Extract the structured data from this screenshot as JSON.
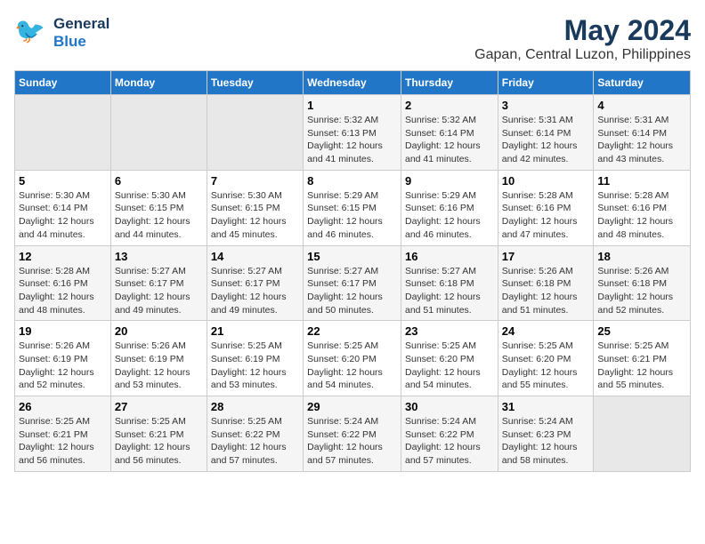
{
  "logo": {
    "general": "General",
    "blue": "Blue",
    "tagline": ""
  },
  "title": "May 2024",
  "subtitle": "Gapan, Central Luzon, Philippines",
  "days_of_week": [
    "Sunday",
    "Monday",
    "Tuesday",
    "Wednesday",
    "Thursday",
    "Friday",
    "Saturday"
  ],
  "weeks": [
    [
      {
        "day": "",
        "sunrise": "",
        "sunset": "",
        "daylight": ""
      },
      {
        "day": "",
        "sunrise": "",
        "sunset": "",
        "daylight": ""
      },
      {
        "day": "",
        "sunrise": "",
        "sunset": "",
        "daylight": ""
      },
      {
        "day": "1",
        "sunrise": "Sunrise: 5:32 AM",
        "sunset": "Sunset: 6:13 PM",
        "daylight": "Daylight: 12 hours and 41 minutes."
      },
      {
        "day": "2",
        "sunrise": "Sunrise: 5:32 AM",
        "sunset": "Sunset: 6:14 PM",
        "daylight": "Daylight: 12 hours and 41 minutes."
      },
      {
        "day": "3",
        "sunrise": "Sunrise: 5:31 AM",
        "sunset": "Sunset: 6:14 PM",
        "daylight": "Daylight: 12 hours and 42 minutes."
      },
      {
        "day": "4",
        "sunrise": "Sunrise: 5:31 AM",
        "sunset": "Sunset: 6:14 PM",
        "daylight": "Daylight: 12 hours and 43 minutes."
      }
    ],
    [
      {
        "day": "5",
        "sunrise": "Sunrise: 5:30 AM",
        "sunset": "Sunset: 6:14 PM",
        "daylight": "Daylight: 12 hours and 44 minutes."
      },
      {
        "day": "6",
        "sunrise": "Sunrise: 5:30 AM",
        "sunset": "Sunset: 6:15 PM",
        "daylight": "Daylight: 12 hours and 44 minutes."
      },
      {
        "day": "7",
        "sunrise": "Sunrise: 5:30 AM",
        "sunset": "Sunset: 6:15 PM",
        "daylight": "Daylight: 12 hours and 45 minutes."
      },
      {
        "day": "8",
        "sunrise": "Sunrise: 5:29 AM",
        "sunset": "Sunset: 6:15 PM",
        "daylight": "Daylight: 12 hours and 46 minutes."
      },
      {
        "day": "9",
        "sunrise": "Sunrise: 5:29 AM",
        "sunset": "Sunset: 6:16 PM",
        "daylight": "Daylight: 12 hours and 46 minutes."
      },
      {
        "day": "10",
        "sunrise": "Sunrise: 5:28 AM",
        "sunset": "Sunset: 6:16 PM",
        "daylight": "Daylight: 12 hours and 47 minutes."
      },
      {
        "day": "11",
        "sunrise": "Sunrise: 5:28 AM",
        "sunset": "Sunset: 6:16 PM",
        "daylight": "Daylight: 12 hours and 48 minutes."
      }
    ],
    [
      {
        "day": "12",
        "sunrise": "Sunrise: 5:28 AM",
        "sunset": "Sunset: 6:16 PM",
        "daylight": "Daylight: 12 hours and 48 minutes."
      },
      {
        "day": "13",
        "sunrise": "Sunrise: 5:27 AM",
        "sunset": "Sunset: 6:17 PM",
        "daylight": "Daylight: 12 hours and 49 minutes."
      },
      {
        "day": "14",
        "sunrise": "Sunrise: 5:27 AM",
        "sunset": "Sunset: 6:17 PM",
        "daylight": "Daylight: 12 hours and 49 minutes."
      },
      {
        "day": "15",
        "sunrise": "Sunrise: 5:27 AM",
        "sunset": "Sunset: 6:17 PM",
        "daylight": "Daylight: 12 hours and 50 minutes."
      },
      {
        "day": "16",
        "sunrise": "Sunrise: 5:27 AM",
        "sunset": "Sunset: 6:18 PM",
        "daylight": "Daylight: 12 hours and 51 minutes."
      },
      {
        "day": "17",
        "sunrise": "Sunrise: 5:26 AM",
        "sunset": "Sunset: 6:18 PM",
        "daylight": "Daylight: 12 hours and 51 minutes."
      },
      {
        "day": "18",
        "sunrise": "Sunrise: 5:26 AM",
        "sunset": "Sunset: 6:18 PM",
        "daylight": "Daylight: 12 hours and 52 minutes."
      }
    ],
    [
      {
        "day": "19",
        "sunrise": "Sunrise: 5:26 AM",
        "sunset": "Sunset: 6:19 PM",
        "daylight": "Daylight: 12 hours and 52 minutes."
      },
      {
        "day": "20",
        "sunrise": "Sunrise: 5:26 AM",
        "sunset": "Sunset: 6:19 PM",
        "daylight": "Daylight: 12 hours and 53 minutes."
      },
      {
        "day": "21",
        "sunrise": "Sunrise: 5:25 AM",
        "sunset": "Sunset: 6:19 PM",
        "daylight": "Daylight: 12 hours and 53 minutes."
      },
      {
        "day": "22",
        "sunrise": "Sunrise: 5:25 AM",
        "sunset": "Sunset: 6:20 PM",
        "daylight": "Daylight: 12 hours and 54 minutes."
      },
      {
        "day": "23",
        "sunrise": "Sunrise: 5:25 AM",
        "sunset": "Sunset: 6:20 PM",
        "daylight": "Daylight: 12 hours and 54 minutes."
      },
      {
        "day": "24",
        "sunrise": "Sunrise: 5:25 AM",
        "sunset": "Sunset: 6:20 PM",
        "daylight": "Daylight: 12 hours and 55 minutes."
      },
      {
        "day": "25",
        "sunrise": "Sunrise: 5:25 AM",
        "sunset": "Sunset: 6:21 PM",
        "daylight": "Daylight: 12 hours and 55 minutes."
      }
    ],
    [
      {
        "day": "26",
        "sunrise": "Sunrise: 5:25 AM",
        "sunset": "Sunset: 6:21 PM",
        "daylight": "Daylight: 12 hours and 56 minutes."
      },
      {
        "day": "27",
        "sunrise": "Sunrise: 5:25 AM",
        "sunset": "Sunset: 6:21 PM",
        "daylight": "Daylight: 12 hours and 56 minutes."
      },
      {
        "day": "28",
        "sunrise": "Sunrise: 5:25 AM",
        "sunset": "Sunset: 6:22 PM",
        "daylight": "Daylight: 12 hours and 57 minutes."
      },
      {
        "day": "29",
        "sunrise": "Sunrise: 5:24 AM",
        "sunset": "Sunset: 6:22 PM",
        "daylight": "Daylight: 12 hours and 57 minutes."
      },
      {
        "day": "30",
        "sunrise": "Sunrise: 5:24 AM",
        "sunset": "Sunset: 6:22 PM",
        "daylight": "Daylight: 12 hours and 57 minutes."
      },
      {
        "day": "31",
        "sunrise": "Sunrise: 5:24 AM",
        "sunset": "Sunset: 6:23 PM",
        "daylight": "Daylight: 12 hours and 58 minutes."
      },
      {
        "day": "",
        "sunrise": "",
        "sunset": "",
        "daylight": ""
      }
    ]
  ]
}
